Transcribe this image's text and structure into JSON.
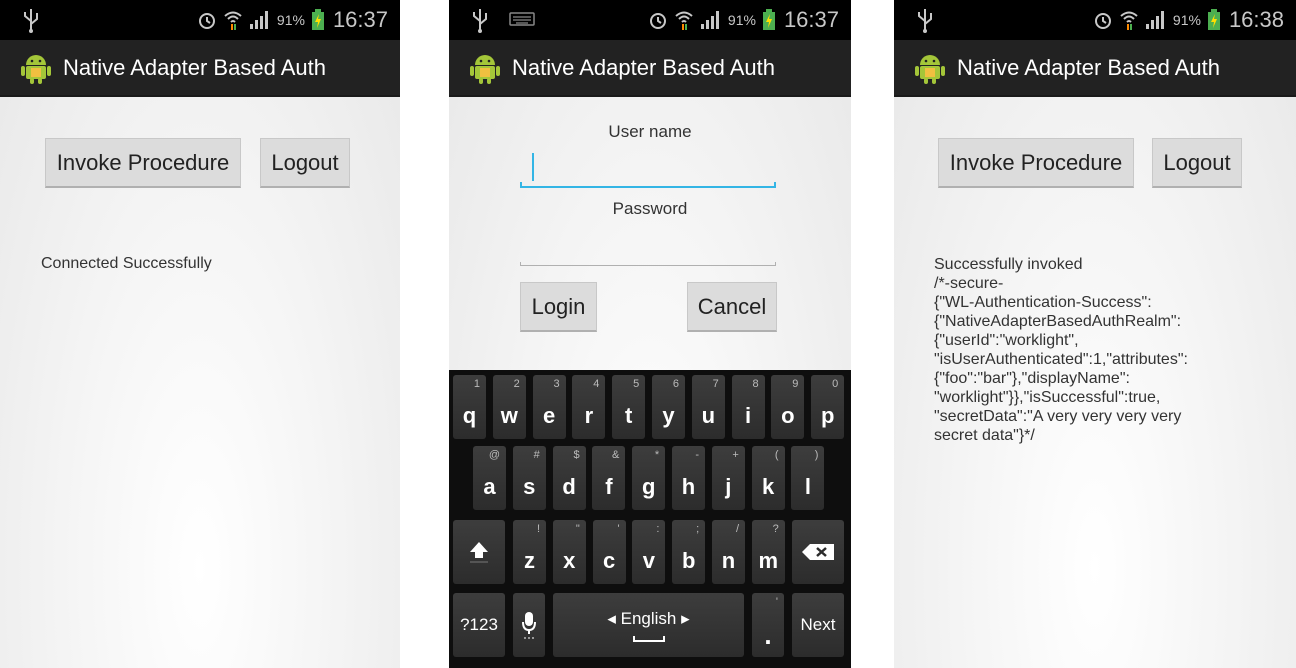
{
  "screens": [
    {
      "status": {
        "battery": "91%",
        "time": "16:37"
      },
      "app_title": "Native Adapter Based Auth",
      "invoke_label": "Invoke Procedure",
      "logout_label": "Logout",
      "message": "Connected Successfully"
    },
    {
      "status": {
        "battery": "91%",
        "time": "16:37"
      },
      "app_title": "Native Adapter Based Auth",
      "username_label": "User name",
      "username_value": "",
      "password_label": "Password",
      "password_value": "",
      "login_label": "Login",
      "cancel_label": "Cancel",
      "keyboard": {
        "row1": [
          {
            "k": "q",
            "h": "1"
          },
          {
            "k": "w",
            "h": "2"
          },
          {
            "k": "e",
            "h": "3"
          },
          {
            "k": "r",
            "h": "4"
          },
          {
            "k": "t",
            "h": "5"
          },
          {
            "k": "y",
            "h": "6"
          },
          {
            "k": "u",
            "h": "7"
          },
          {
            "k": "i",
            "h": "8"
          },
          {
            "k": "o",
            "h": "9"
          },
          {
            "k": "p",
            "h": "0"
          }
        ],
        "row2": [
          {
            "k": "a",
            "h": "@"
          },
          {
            "k": "s",
            "h": "#"
          },
          {
            "k": "d",
            "h": "$"
          },
          {
            "k": "f",
            "h": "&"
          },
          {
            "k": "g",
            "h": "*"
          },
          {
            "k": "h",
            "h": "-"
          },
          {
            "k": "j",
            "h": "+"
          },
          {
            "k": "k",
            "h": "("
          },
          {
            "k": "l",
            "h": ")"
          }
        ],
        "row3": [
          {
            "k": "z",
            "h": "!"
          },
          {
            "k": "x",
            "h": "\""
          },
          {
            "k": "c",
            "h": "'"
          },
          {
            "k": "v",
            "h": ":"
          },
          {
            "k": "b",
            "h": ";"
          },
          {
            "k": "n",
            "h": "/"
          },
          {
            "k": "m",
            "h": "?"
          }
        ],
        "symbols_label": "?123",
        "language_label": "English",
        "period_label": ".",
        "period_hint": "'",
        "next_label": "Next",
        "shift_icon": "shift-icon",
        "backspace_icon": "backspace-icon",
        "mic_icon": "microphone-icon"
      }
    },
    {
      "status": {
        "battery": "91%",
        "time": "16:38"
      },
      "app_title": "Native Adapter Based Auth",
      "invoke_label": "Invoke Procedure",
      "logout_label": "Logout",
      "message_lines": [
        "Successfully invoked",
        "/*-secure-",
        "{\"WL-Authentication-Success\":",
        "{\"NativeAdapterBasedAuthRealm\":",
        "{\"userId\":\"worklight\",",
        "\"isUserAuthenticated\":1,\"attributes\":",
        "{\"foo\":\"bar\"},\"displayName\":",
        "\"worklight\"}},\"isSuccessful\":true,",
        "\"secretData\":\"A very very very very",
        "secret data\"}*/"
      ]
    }
  ],
  "colors": {
    "actionbar": "#222222",
    "statusbar": "#000000",
    "focus_blue": "#33b5e5",
    "android_green": "#a4c639"
  }
}
